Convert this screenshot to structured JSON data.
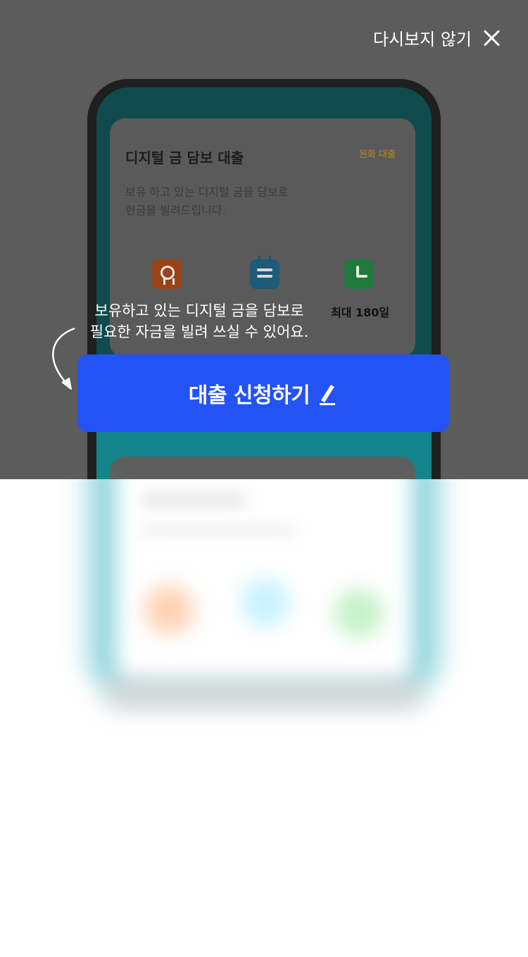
{
  "header": {
    "dismiss_label": "다시보지 않기"
  },
  "card": {
    "title": "디지털 금 담보 대출",
    "badge": "원화 대출",
    "description_line1": "보유 하고 있는 디지털 금을 담보로",
    "description_line2": "현금을 빌려드립니다.",
    "features": [
      {
        "icon": "award-icon",
        "label": ""
      },
      {
        "icon": "calendar-icon",
        "label": ""
      },
      {
        "icon": "clock-icon",
        "label": "최대 180일"
      }
    ]
  },
  "coachmark": {
    "line1": "보유하고 있는 디지털 금을 담보로",
    "line2": "필요한 자금을 빌려 쓰실 수 있어요."
  },
  "cta": {
    "label": "대출 신청하기",
    "icon": "pencil-icon",
    "color": "#2352f5"
  }
}
